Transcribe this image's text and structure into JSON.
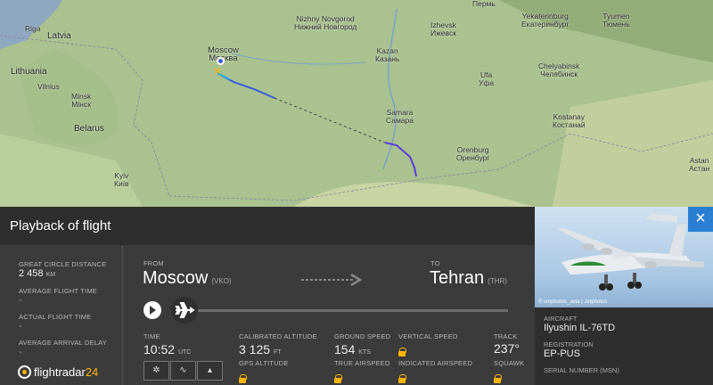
{
  "map": {
    "countries": [
      "Latvia",
      "Lithuania",
      "Belarus"
    ],
    "cities": [
      {
        "name": "Riga"
      },
      {
        "name": "Vilnius"
      },
      {
        "name": "Minsk",
        "alt": "Мінск"
      },
      {
        "name": "Kyiv",
        "alt": "Київ"
      },
      {
        "name": "Moscow",
        "alt": "Москва"
      },
      {
        "name": "Nizhny Novgorod",
        "alt": "Нижний Новгород"
      },
      {
        "name": "Kazan",
        "alt": "Казань"
      },
      {
        "name": "Izhevsk",
        "alt": "Ижевск"
      },
      {
        "name": "Perm",
        "alt": "Пермь"
      },
      {
        "name": "Yekaterinburg",
        "alt": "Екатеринбург"
      },
      {
        "name": "Tyumen",
        "alt": "Тюмень"
      },
      {
        "name": "Ufa",
        "alt": "Уфа"
      },
      {
        "name": "Chelyabinsk",
        "alt": "Челябинск"
      },
      {
        "name": "Samara",
        "alt": "Самара"
      },
      {
        "name": "Orenburg",
        "alt": "Оренбург"
      },
      {
        "name": "Kostanay",
        "alt": "Костанай"
      },
      {
        "name": "Astan",
        "alt": "Астан"
      }
    ]
  },
  "panel": {
    "title": "Playback of flight",
    "great_circle": {
      "label": "GREAT CIRCLE DISTANCE",
      "value": "2 458",
      "unit": "KM"
    },
    "avg_flight_time": {
      "label": "AVERAGE FLIGHT TIME",
      "value": "-"
    },
    "actual_flight_time": {
      "label": "ACTUAL FLIGHT TIME",
      "value": "-"
    },
    "avg_arrival_delay": {
      "label": "AVERAGE ARRIVAL DELAY",
      "value": "-"
    },
    "logo": {
      "part1": "flightradar",
      "part2": "24"
    },
    "from": {
      "label": "FROM",
      "city": "Moscow",
      "code": "(VKO)"
    },
    "to": {
      "label": "TO",
      "city": "Tehran",
      "code": "(THR)"
    },
    "time": {
      "label": "TIME",
      "value": "10:52",
      "unit": "UTC"
    },
    "cal_alt": {
      "label": "CALIBRATED ALTITUDE",
      "value": "3 125",
      "unit": "FT"
    },
    "gps_alt": {
      "label": "GPS ALTITUDE"
    },
    "ground_speed": {
      "label": "GROUND SPEED",
      "value": "154",
      "unit": "KTS"
    },
    "true_airspeed": {
      "label": "TRUE AIRSPEED"
    },
    "vertical_speed": {
      "label": "VERTICAL SPEED"
    },
    "indicated_airspeed": {
      "label": "INDICATED AIRSPEED"
    },
    "track": {
      "label": "TRACK",
      "value": "237°"
    },
    "squawk": {
      "label": "SQUAWK"
    }
  },
  "aircraft": {
    "photo_credit": "© smphotos_avia | Jetphotos",
    "aircraft_label": "AIRCRAFT",
    "aircraft_value": "Ilyushin IL-76TD",
    "reg_label": "REGISTRATION",
    "reg_value": "EP-PUS",
    "serial_label": "SERIAL NUMBER (MSN)"
  },
  "icons": {
    "close": "×",
    "play": "play-icon"
  },
  "colors": {
    "accent": "#ffb400",
    "close_bg": "#2a7fd4",
    "track_blue": "#3a5bd9"
  }
}
